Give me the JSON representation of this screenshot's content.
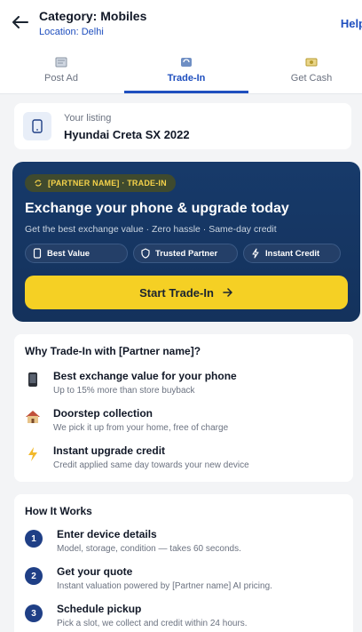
{
  "header": {
    "title": "Category: Mobiles",
    "location": "Location: Delhi",
    "help": "Help"
  },
  "tabs": [
    {
      "label": "Post Ad",
      "icon": "post-ad-icon",
      "active": false
    },
    {
      "label": "Trade-In",
      "icon": "trade-in-icon",
      "active": true
    },
    {
      "label": "Get Cash",
      "icon": "cash-icon",
      "active": false
    }
  ],
  "listing": {
    "label": "Your listing",
    "value": "Hyundai Creta SX 2022",
    "icon": "phone-icon"
  },
  "hero": {
    "badge": "[PARTNER NAME] · TRADE-IN",
    "title": "Exchange your phone & upgrade today",
    "subtitle": "Get the best exchange value · Zero hassle · Same-day credit",
    "chips": [
      {
        "label": "Best Value",
        "icon": "tag-icon"
      },
      {
        "label": "Trusted Partner",
        "icon": "shield-icon"
      },
      {
        "label": "Instant Credit",
        "icon": "bolt-icon"
      }
    ],
    "cta": "Start Trade-In",
    "colors": {
      "background": "#173a6a",
      "cta": "#f5d024",
      "badge_text": "#f5d24a"
    }
  },
  "why": {
    "title": "Why Trade-In with [Partner name]?",
    "items": [
      {
        "title": "Best exchange value for your phone",
        "desc": "Up to 15% more than store buyback",
        "icon": "mobile-phone-icon"
      },
      {
        "title": "Doorstep collection",
        "desc": "We pick it up from your home, free of charge",
        "icon": "house-icon"
      },
      {
        "title": "Instant upgrade credit",
        "desc": "Credit applied same day towards your new device",
        "icon": "lightning-icon"
      }
    ]
  },
  "how": {
    "title": "How It Works",
    "steps": [
      {
        "num": "1",
        "title": "Enter device details",
        "desc": "Model, storage, condition — takes 60 seconds."
      },
      {
        "num": "2",
        "title": "Get your quote",
        "desc": "Instant valuation powered by [Partner name] AI pricing."
      },
      {
        "num": "3",
        "title": "Schedule pickup",
        "desc": "Pick a slot, we collect and credit within 24 hours."
      }
    ]
  }
}
